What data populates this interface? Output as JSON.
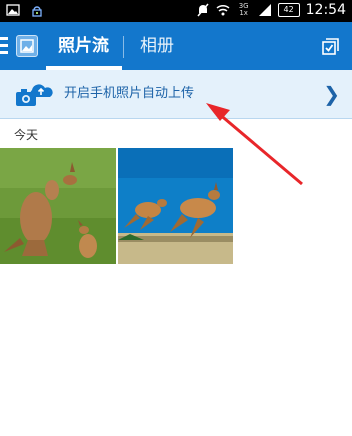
{
  "status_bar": {
    "network_top": "3G",
    "network_bottom": "1x",
    "battery": "42",
    "time": "12:54"
  },
  "header": {
    "tabs": [
      {
        "label": "照片流"
      },
      {
        "label": "相册"
      }
    ]
  },
  "banner": {
    "text": "开启手机照片自动上传",
    "chevron": "❯"
  },
  "section": {
    "label": "今天"
  },
  "colors": {
    "header_bg": "#1377cc",
    "banner_bg": "#e4f1fb",
    "annotation": "#e8262a"
  }
}
